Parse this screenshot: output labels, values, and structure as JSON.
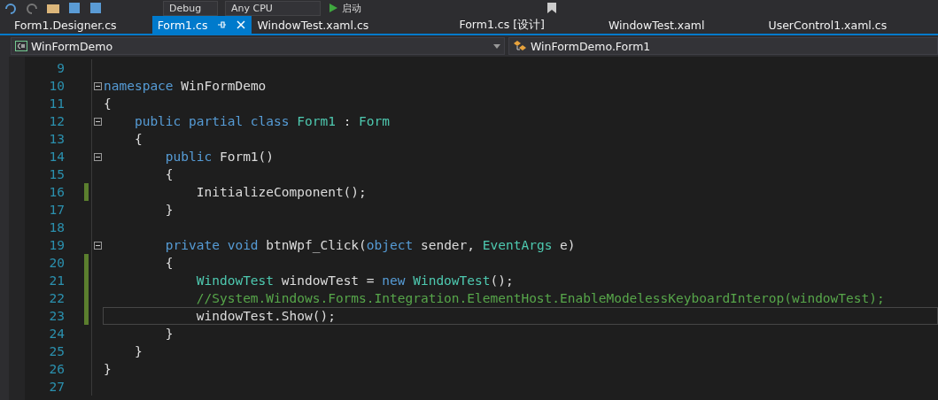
{
  "toolbar": {
    "configuration": "Debug",
    "platform": "Any CPU",
    "start_label": "启动"
  },
  "tabs": [
    {
      "label": "Form1.Designer.cs",
      "selected": false
    },
    {
      "label": "Form1.cs",
      "selected": true
    },
    {
      "label": "WindowTest.xaml.cs",
      "selected": false
    },
    {
      "label": "Form1.cs [设计]",
      "selected": false
    },
    {
      "label": "WindowTest.xaml",
      "selected": false
    },
    {
      "label": "UserControl1.xaml.cs",
      "selected": false
    }
  ],
  "navigation_bar": {
    "project": "WinFormDemo",
    "type": "WinFormDemo.Form1"
  },
  "editor": {
    "lines": [
      {
        "number": "9",
        "changed": false,
        "foldable": false,
        "current": false
      },
      {
        "number": "10",
        "changed": false,
        "foldable": true,
        "current": false,
        "tokens": [
          {
            "text": "namespace",
            "kind": "keyword"
          },
          {
            "text": " WinFormDemo",
            "kind": "plain"
          }
        ]
      },
      {
        "number": "11",
        "changed": false,
        "foldable": false,
        "current": false,
        "tokens": [
          {
            "text": "{",
            "kind": "plain"
          }
        ]
      },
      {
        "number": "12",
        "changed": false,
        "foldable": true,
        "current": false,
        "tokens": [
          {
            "text": "    public partial class ",
            "kind": "keyword"
          },
          {
            "text": "Form1",
            "kind": "type"
          },
          {
            "text": " : ",
            "kind": "plain"
          },
          {
            "text": "Form",
            "kind": "type"
          }
        ]
      },
      {
        "number": "13",
        "changed": false,
        "foldable": false,
        "current": false,
        "tokens": [
          {
            "text": "    {",
            "kind": "plain"
          }
        ]
      },
      {
        "number": "14",
        "changed": false,
        "foldable": true,
        "current": false,
        "tokens": [
          {
            "text": "        public",
            "kind": "keyword"
          },
          {
            "text": " Form1()",
            "kind": "plain"
          }
        ]
      },
      {
        "number": "15",
        "changed": false,
        "foldable": false,
        "current": false,
        "tokens": [
          {
            "text": "        {",
            "kind": "plain"
          }
        ]
      },
      {
        "number": "16",
        "changed": true,
        "foldable": false,
        "current": false,
        "tokens": [
          {
            "text": "            InitializeComponent();",
            "kind": "plain"
          }
        ]
      },
      {
        "number": "17",
        "changed": false,
        "foldable": false,
        "current": false,
        "tokens": [
          {
            "text": "        }",
            "kind": "plain"
          }
        ]
      },
      {
        "number": "18",
        "changed": false,
        "foldable": false,
        "current": false
      },
      {
        "number": "19",
        "changed": false,
        "foldable": true,
        "current": false,
        "tokens": [
          {
            "text": "        private void",
            "kind": "keyword"
          },
          {
            "text": " btnWpf_Click(",
            "kind": "plain"
          },
          {
            "text": "object",
            "kind": "keyword"
          },
          {
            "text": " sender, ",
            "kind": "plain"
          },
          {
            "text": "EventArgs",
            "kind": "type"
          },
          {
            "text": " e)",
            "kind": "plain"
          }
        ]
      },
      {
        "number": "20",
        "changed": true,
        "foldable": false,
        "current": false,
        "tokens": [
          {
            "text": "        {",
            "kind": "plain"
          }
        ]
      },
      {
        "number": "21",
        "changed": true,
        "foldable": false,
        "current": false,
        "tokens": [
          {
            "text": "            WindowTest",
            "kind": "type"
          },
          {
            "text": " windowTest = ",
            "kind": "plain"
          },
          {
            "text": "new ",
            "kind": "keyword"
          },
          {
            "text": "WindowTest",
            "kind": "type"
          },
          {
            "text": "();",
            "kind": "plain"
          }
        ]
      },
      {
        "number": "22",
        "changed": true,
        "foldable": false,
        "current": false,
        "tokens": [
          {
            "text": "            //System.Windows.Forms.Integration.ElementHost.EnableModelessKeyboardInterop(windowTest);",
            "kind": "comment"
          }
        ]
      },
      {
        "number": "23",
        "changed": true,
        "foldable": false,
        "current": true,
        "tokens": [
          {
            "text": "            windowTest.Show();",
            "kind": "plain"
          }
        ]
      },
      {
        "number": "24",
        "changed": false,
        "foldable": false,
        "current": false,
        "tokens": [
          {
            "text": "        }",
            "kind": "plain"
          }
        ]
      },
      {
        "number": "25",
        "changed": false,
        "foldable": false,
        "current": false,
        "tokens": [
          {
            "text": "    }",
            "kind": "plain"
          }
        ]
      },
      {
        "number": "26",
        "changed": false,
        "foldable": false,
        "current": false,
        "tokens": [
          {
            "text": "}",
            "kind": "plain"
          }
        ]
      },
      {
        "number": "27",
        "changed": false,
        "foldable": false,
        "current": false
      }
    ]
  }
}
